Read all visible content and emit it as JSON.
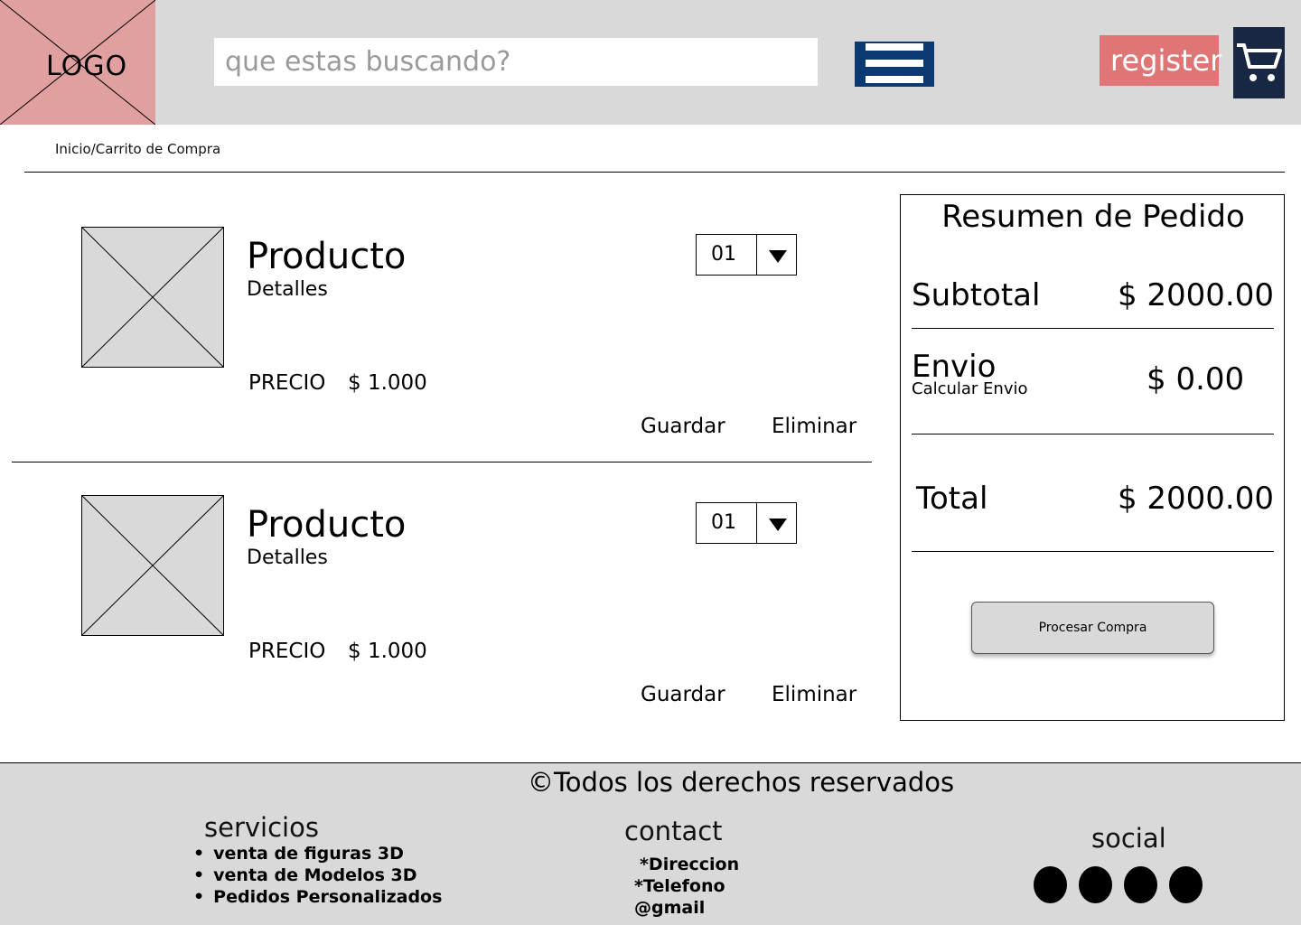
{
  "header": {
    "logo_text": "LOGO",
    "search_placeholder": "que estas buscando?",
    "register_label": "register"
  },
  "breadcrumb": "Inicio/Carrito de Compra",
  "cart_items": [
    {
      "name": "Producto",
      "details": "Detalles",
      "price_label": "PRECIO",
      "price": "$ 1.000",
      "quantity": "01",
      "save_label": "Guardar",
      "delete_label": "Eliminar"
    },
    {
      "name": "Producto",
      "details": "Detalles",
      "price_label": "PRECIO",
      "price": "$ 1.000",
      "quantity": "01",
      "save_label": "Guardar",
      "delete_label": "Eliminar"
    }
  ],
  "summary": {
    "title": "Resumen de Pedido",
    "subtotal_label": "Subtotal",
    "subtotal_value": "$ 2000.00",
    "shipping_label": "Envio",
    "shipping_calc_label": "Calcular Envio",
    "shipping_value": "$ 0.00",
    "total_label": "Total",
    "total_value": "$ 2000.00",
    "checkout_label": "Procesar Compra"
  },
  "footer": {
    "copyright": "©Todos los derechos reservados",
    "services_title": "servicios",
    "services": [
      "venta de figuras 3D",
      "venta de Modelos 3D",
      "Pedidos Personalizados"
    ],
    "contact_title": "contact",
    "contact_lines": [
      "*Direccion",
      "*Telefono",
      "@gmail"
    ],
    "social_title": "social"
  },
  "colors": {
    "header_bg": "#d9d9d9",
    "logo_bg": "#e0a0a0",
    "menu_button": "#0b3a73",
    "register_button": "#e07575",
    "cart_button": "#192842"
  }
}
